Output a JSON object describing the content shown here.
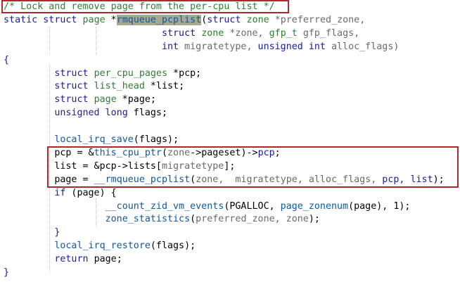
{
  "editor": {
    "lines": [
      [
        {
          "t": "/* ",
          "c": "cm"
        },
        {
          "t": "Lock and remove page from the per-cpu list",
          "c": "cm"
        },
        {
          "t": " */",
          "c": "cm"
        }
      ],
      [
        {
          "t": "static ",
          "c": "kw"
        },
        {
          "t": "struct ",
          "c": "kw"
        },
        {
          "t": "page ",
          "c": "ty"
        },
        {
          "t": "*",
          "c": "plain"
        },
        {
          "t": "rmqueue_pcplist",
          "c": "fn",
          "hl": true
        },
        {
          "t": "(",
          "c": "plain"
        },
        {
          "t": "struct ",
          "c": "kw"
        },
        {
          "t": "zone ",
          "c": "ty"
        },
        {
          "t": "*preferred_zone,",
          "c": "arg"
        }
      ],
      [
        {
          "t": "                            ",
          "c": "plain"
        },
        {
          "t": "struct ",
          "c": "kw"
        },
        {
          "t": "zone ",
          "c": "ty"
        },
        {
          "t": "*zone, ",
          "c": "arg"
        },
        {
          "t": "gfp_t ",
          "c": "ty"
        },
        {
          "t": "gfp_flags,",
          "c": "arg"
        }
      ],
      [
        {
          "t": "                            ",
          "c": "plain"
        },
        {
          "t": "int ",
          "c": "kw"
        },
        {
          "t": "migratetype, ",
          "c": "arg"
        },
        {
          "t": "unsigned ",
          "c": "kw"
        },
        {
          "t": "int ",
          "c": "kw"
        },
        {
          "t": "alloc_flags)",
          "c": "arg"
        }
      ],
      [
        {
          "t": "{",
          "c": "kw"
        }
      ],
      [
        {
          "t": "         ",
          "c": "plain"
        },
        {
          "t": "struct ",
          "c": "kw"
        },
        {
          "t": "per_cpu_pages ",
          "c": "ty"
        },
        {
          "t": "*pcp;",
          "c": "plain"
        }
      ],
      [
        {
          "t": "         ",
          "c": "plain"
        },
        {
          "t": "struct ",
          "c": "kw"
        },
        {
          "t": "list_head ",
          "c": "ty"
        },
        {
          "t": "*list;",
          "c": "plain"
        }
      ],
      [
        {
          "t": "         ",
          "c": "plain"
        },
        {
          "t": "struct ",
          "c": "kw"
        },
        {
          "t": "page ",
          "c": "ty"
        },
        {
          "t": "*page;",
          "c": "plain"
        }
      ],
      [
        {
          "t": "         ",
          "c": "plain"
        },
        {
          "t": "unsigned ",
          "c": "kw"
        },
        {
          "t": "long ",
          "c": "kw"
        },
        {
          "t": "flags;",
          "c": "plain"
        }
      ],
      [],
      [
        {
          "t": "         ",
          "c": "plain"
        },
        {
          "t": "local_irq_save",
          "c": "fn"
        },
        {
          "t": "(flags);",
          "c": "plain"
        }
      ],
      [
        {
          "t": "         ",
          "c": "plain"
        },
        {
          "t": "pcp = &",
          "c": "plain"
        },
        {
          "t": "this_cpu_ptr",
          "c": "fn"
        },
        {
          "t": "(",
          "c": "plain"
        },
        {
          "t": "zone",
          "c": "arg"
        },
        {
          "t": "->pageset)->",
          "c": "plain"
        },
        {
          "t": "pcp",
          "c": "var"
        },
        {
          "t": ";",
          "c": "plain"
        }
      ],
      [
        {
          "t": "         ",
          "c": "plain"
        },
        {
          "t": "list = &pcp->lists[",
          "c": "plain"
        },
        {
          "t": "migratetype",
          "c": "arg"
        },
        {
          "t": "];",
          "c": "plain"
        }
      ],
      [
        {
          "t": "         ",
          "c": "plain"
        },
        {
          "t": "page = ",
          "c": "plain"
        },
        {
          "t": "__rmqueue_pcplist",
          "c": "fn"
        },
        {
          "t": "(",
          "c": "plain"
        },
        {
          "t": "zone,  migratetype, alloc_flags, ",
          "c": "arg"
        },
        {
          "t": "pcp, list",
          "c": "var"
        },
        {
          "t": ");",
          "c": "plain"
        }
      ],
      [
        {
          "t": "         ",
          "c": "plain"
        },
        {
          "t": "if ",
          "c": "kw"
        },
        {
          "t": "(page) {",
          "c": "plain"
        }
      ],
      [
        {
          "t": "                  ",
          "c": "plain"
        },
        {
          "t": "__count_zid_vm_events",
          "c": "fn"
        },
        {
          "t": "(PGALLOC, ",
          "c": "plain"
        },
        {
          "t": "page_zonenum",
          "c": "fn"
        },
        {
          "t": "(page), 1);",
          "c": "plain"
        }
      ],
      [
        {
          "t": "                  ",
          "c": "plain"
        },
        {
          "t": "zone_statistics",
          "c": "fn"
        },
        {
          "t": "(",
          "c": "plain"
        },
        {
          "t": "preferred_zone, zone",
          "c": "arg"
        },
        {
          "t": ");",
          "c": "plain"
        }
      ],
      [
        {
          "t": "         ",
          "c": "plain"
        },
        {
          "t": "}",
          "c": "kw"
        }
      ],
      [
        {
          "t": "         ",
          "c": "plain"
        },
        {
          "t": "local_irq_restore",
          "c": "fn"
        },
        {
          "t": "(flags);",
          "c": "plain"
        }
      ],
      [
        {
          "t": "         ",
          "c": "plain"
        },
        {
          "t": "return ",
          "c": "kw"
        },
        {
          "t": "page;",
          "c": "plain"
        }
      ],
      [
        {
          "t": "}",
          "c": "kw"
        }
      ]
    ]
  }
}
